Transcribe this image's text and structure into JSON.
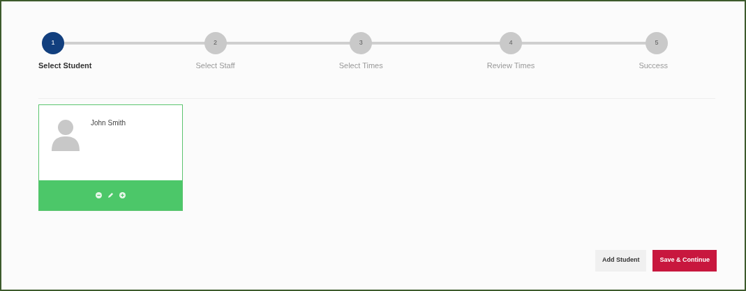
{
  "steps": [
    {
      "number": "1",
      "label": "Select Student",
      "selected": true
    },
    {
      "number": "2",
      "label": "Select Staff",
      "selected": false
    },
    {
      "number": "3",
      "label": "Select Times",
      "selected": false
    },
    {
      "number": "4",
      "label": "Review Times",
      "selected": false
    },
    {
      "number": "5",
      "label": "Success",
      "selected": false
    }
  ],
  "students": [
    {
      "name": "John Smith",
      "selected": true
    }
  ],
  "buttons": [
    {
      "kind": "secondary",
      "label": "Add Student"
    },
    {
      "kind": "primary",
      "label": "Save & Continue"
    }
  ]
}
